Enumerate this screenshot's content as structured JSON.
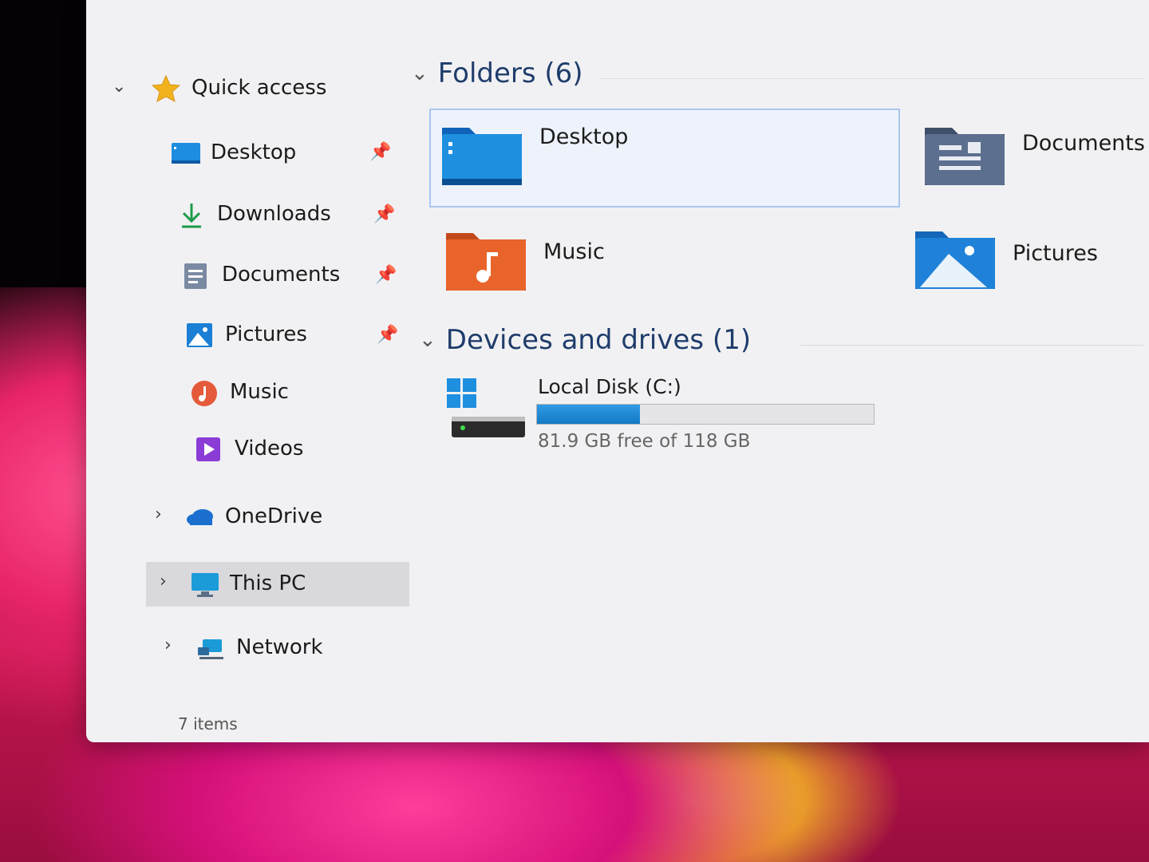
{
  "status_bar": {
    "item_count": "7 items"
  },
  "nav": {
    "quick_access": {
      "label": "Quick access",
      "icon": "star-icon"
    },
    "pinned": [
      {
        "label": "Desktop",
        "icon": "desktop-folder-icon"
      },
      {
        "label": "Downloads",
        "icon": "download-icon"
      },
      {
        "label": "Documents",
        "icon": "documents-icon"
      },
      {
        "label": "Pictures",
        "icon": "pictures-icon"
      }
    ],
    "unpinned": [
      {
        "label": "Music",
        "icon": "music-icon"
      },
      {
        "label": "Videos",
        "icon": "videos-icon"
      }
    ],
    "onedrive": {
      "label": "OneDrive",
      "icon": "cloud-icon"
    },
    "this_pc": {
      "label": "This PC",
      "icon": "monitor-icon"
    },
    "network": {
      "label": "Network",
      "icon": "network-icon"
    }
  },
  "content": {
    "folders_header": "Folders (6)",
    "folders": [
      {
        "label": "Desktop",
        "icon": "desktop-folder-icon",
        "color": "#1f8fe0"
      },
      {
        "label": "Documents",
        "icon": "documents-folder-icon",
        "color": "#5d6f8f"
      },
      {
        "label": "Music",
        "icon": "music-folder-icon",
        "color": "#e8642a"
      },
      {
        "label": "Pictures",
        "icon": "pictures-folder-icon",
        "color": "#1f82d8"
      }
    ],
    "devices_header": "Devices and drives (1)",
    "drive": {
      "label": "Local Disk (C:)",
      "free_text": "81.9 GB free of 118 GB",
      "used_fraction": 0.306,
      "bar_color": "#1a86d6"
    }
  }
}
